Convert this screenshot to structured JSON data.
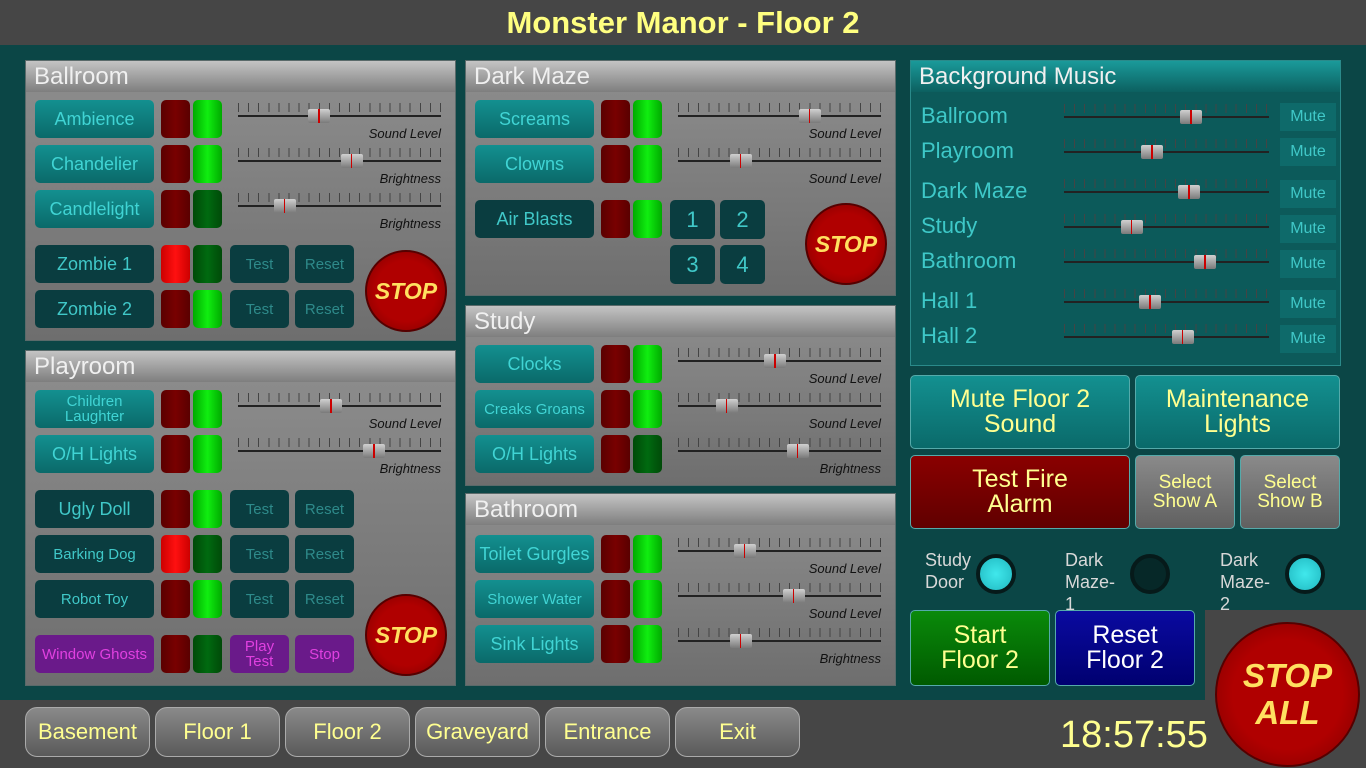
{
  "title": "Monster Manor - Floor 2",
  "colors": {
    "lamp_red_on": "#ff1010",
    "lamp_red_off": "#780000",
    "lamp_green_on": "#10ee10",
    "lamp_green_off": "#006a10",
    "title": "#ffff80",
    "led_on": "#40e8ec",
    "led_off": "#062828"
  },
  "ballroom": {
    "title": "Ballroom",
    "stop": "STOP",
    "rows": [
      {
        "label": "Ambience",
        "style": "teal",
        "red": false,
        "green": true,
        "slider": 0.4,
        "slider_label": "Sound Level"
      },
      {
        "label": "Chandelier",
        "style": "teal",
        "red": false,
        "green": true,
        "slider": 0.56,
        "slider_label": "Brightness"
      },
      {
        "label": "Candlelight",
        "style": "teal",
        "red": false,
        "green": false,
        "slider": 0.23,
        "slider_label": "Brightness"
      },
      {
        "label": "Zombie 1",
        "style": "dark",
        "red": true,
        "green": false,
        "test": "Test",
        "reset": "Reset"
      },
      {
        "label": "Zombie 2",
        "style": "dark",
        "red": false,
        "green": true,
        "test": "Test",
        "reset": "Reset"
      }
    ]
  },
  "playroom": {
    "title": "Playroom",
    "stop": "STOP",
    "rows": [
      {
        "label": "Children Laughter",
        "style": "teal small",
        "red": false,
        "green": true,
        "slider": 0.46,
        "slider_label": "Sound Level"
      },
      {
        "label": "O/H Lights",
        "style": "teal",
        "red": false,
        "green": true,
        "slider": 0.67,
        "slider_label": "Brightness"
      },
      {
        "label": "Ugly Doll",
        "style": "dark",
        "red": false,
        "green": true,
        "test": "Test",
        "reset": "Reset"
      },
      {
        "label": "Barking Dog",
        "style": "dark small",
        "red": true,
        "green": false,
        "test": "Test",
        "reset": "Reset"
      },
      {
        "label": "Robot Toy",
        "style": "dark small",
        "red": false,
        "green": true,
        "test": "Test",
        "reset": "Reset"
      },
      {
        "label": "Window Ghosts",
        "style": "purple",
        "red": false,
        "green": false,
        "test": "Play Test",
        "reset": "Stop"
      }
    ]
  },
  "dark_maze": {
    "title": "Dark Maze",
    "stop": "STOP",
    "numbers": [
      "1",
      "2",
      "3",
      "4"
    ],
    "rows": [
      {
        "label": "Screams",
        "style": "teal",
        "red": false,
        "green": true,
        "slider": 0.65,
        "slider_label": "Sound Level"
      },
      {
        "label": "Clowns",
        "style": "teal",
        "red": false,
        "green": true,
        "slider": 0.31,
        "slider_label": "Sound Level"
      },
      {
        "label": "Air Blasts",
        "style": "dark",
        "red": false,
        "green": true
      }
    ]
  },
  "study": {
    "title": "Study",
    "rows": [
      {
        "label": "Clocks",
        "style": "teal",
        "red": false,
        "green": true,
        "slider": 0.48,
        "slider_label": "Sound Level"
      },
      {
        "label": "Creaks Groans",
        "style": "teal small",
        "red": false,
        "green": true,
        "slider": 0.24,
        "slider_label": "Sound Level"
      },
      {
        "label": "O/H Lights",
        "style": "teal",
        "red": false,
        "green": false,
        "slider": 0.59,
        "slider_label": "Brightness"
      }
    ]
  },
  "bathroom": {
    "title": "Bathroom",
    "rows": [
      {
        "label": "Toilet Gurgles",
        "style": "teal",
        "red": false,
        "green": true,
        "slider": 0.33,
        "slider_label": "Sound Level"
      },
      {
        "label": "Shower Water",
        "style": "teal small",
        "red": false,
        "green": true,
        "slider": 0.57,
        "slider_label": "Sound Level"
      },
      {
        "label": "Sink Lights",
        "style": "teal",
        "red": false,
        "green": true,
        "slider": 0.31,
        "slider_label": "Brightness"
      }
    ]
  },
  "music": {
    "title": "Background Music",
    "mute_label": "Mute",
    "channels": [
      {
        "label": "Ballroom",
        "level": 0.62
      },
      {
        "label": "Playroom",
        "level": 0.43
      },
      {
        "label": "Dark Maze",
        "level": 0.61
      },
      {
        "label": "Study",
        "level": 0.33
      },
      {
        "label": "Bathroom",
        "level": 0.69
      },
      {
        "label": "Hall 1",
        "level": 0.42
      },
      {
        "label": "Hall 2",
        "level": 0.58
      }
    ]
  },
  "controls": {
    "mute_floor": "Mute Floor 2 Sound",
    "maintenance": "Maintenance Lights",
    "fire_alarm": "Test Fire Alarm",
    "show_a": "Select Show A",
    "show_b": "Select Show B",
    "start": "Start Floor 2",
    "reset": "Reset Floor 2",
    "stop_all": "STOP ALL"
  },
  "sensors": [
    {
      "label": "Study Door",
      "on": true
    },
    {
      "label": "Dark Maze-1",
      "on": false
    },
    {
      "label": "Dark Maze-2",
      "on": true
    }
  ],
  "nav": [
    "Basement",
    "Floor 1",
    "Floor 2",
    "Graveyard",
    "Entrance",
    "Exit"
  ],
  "clock": "18:57:55"
}
